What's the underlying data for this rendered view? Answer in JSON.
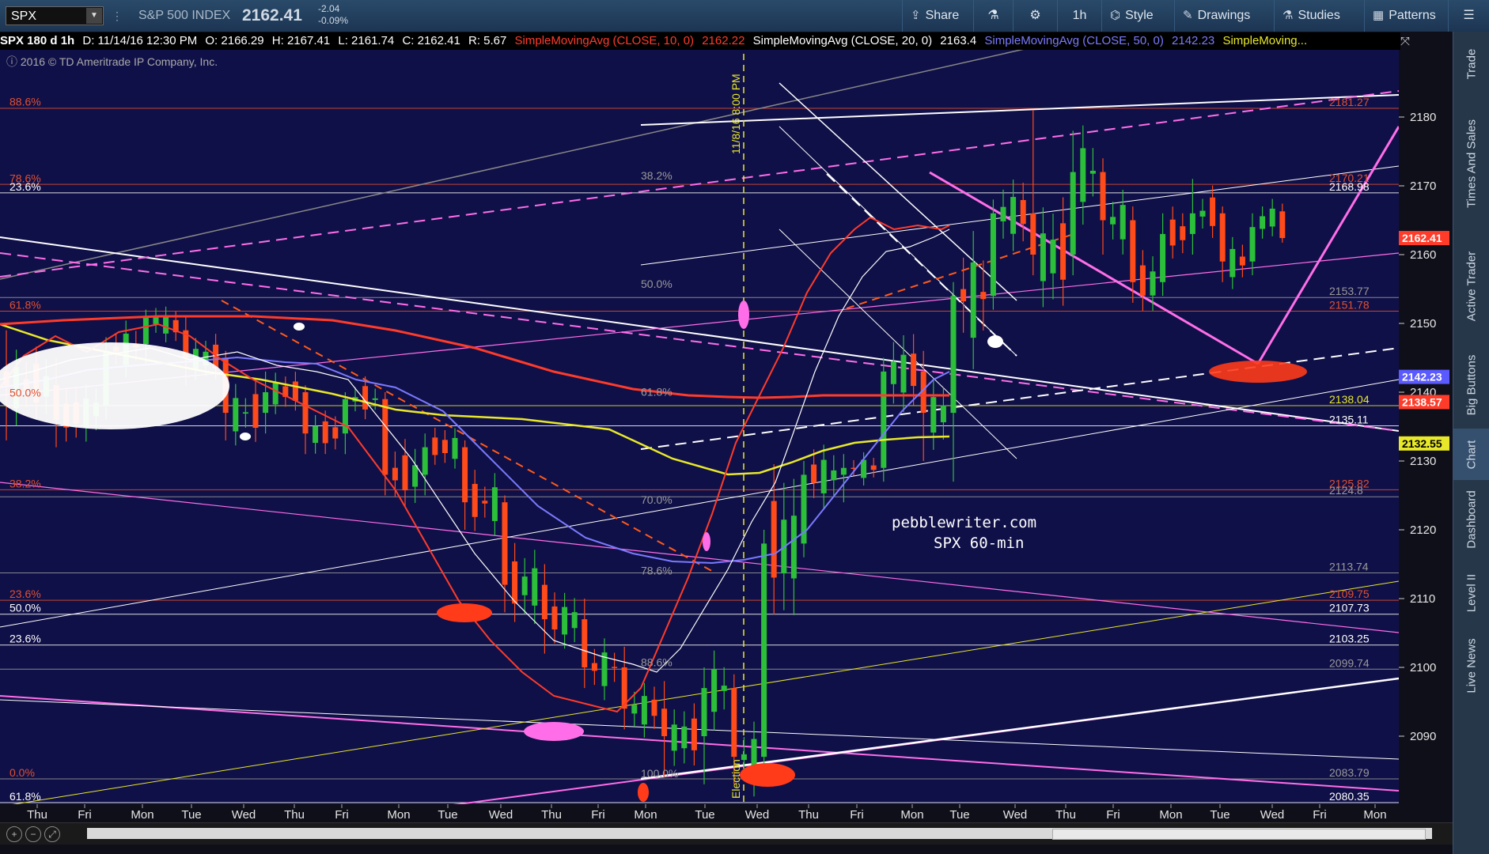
{
  "toolbar": {
    "symbol": "SPX",
    "symbol_name": "S&P 500 INDEX",
    "last_price": "2162.41",
    "change": "-2.04",
    "change_pct": "-0.09%",
    "buttons": {
      "share": "Share",
      "timeframe": "1h",
      "style": "Style",
      "drawings": "Drawings",
      "studies": "Studies",
      "patterns": "Patterns"
    }
  },
  "header": {
    "info": "SPX 180 d 1h",
    "date": "D: 11/14/16 12:30 PM",
    "open": "O: 2166.29",
    "high": "H: 2167.41",
    "low": "L: 2161.74",
    "close": "C: 2162.41",
    "range": "R: 5.67",
    "sma10": "SimpleMovingAvg (CLOSE, 10, 0)",
    "sma10_val": "2162.22",
    "sma20": "SimpleMovingAvg (CLOSE, 20, 0)",
    "sma20_val": "2163.4",
    "sma50": "SimpleMovingAvg (CLOSE, 50, 0)",
    "sma50_val": "2142.23",
    "sma_more": "SimpleMoving...",
    "copyright": "ⓘ 2016 © TD Ameritrade IP Company, Inc."
  },
  "watermark": {
    "line1": "pebblewriter.com",
    "line2": "SPX 60-min"
  },
  "sidebar": {
    "tabs": [
      "Trade",
      "Times And Sales",
      "Active Trader",
      "Big Buttons",
      "Chart",
      "Dashboard",
      "Level II",
      "Live News"
    ],
    "active": "Chart"
  },
  "colors": {
    "background": "#0f0f1a",
    "plot_bg": "#101040",
    "up": "#2bbf3a",
    "down": "#ff4a1a",
    "sma10": "#ff3b2a",
    "sma20": "#ffffff",
    "sma50": "#7a7aff",
    "sma200": "#e8e82a",
    "magenta": "#ff6ee8",
    "fib": "#e05030"
  },
  "chart_data": {
    "type": "candlestick",
    "title": "",
    "ylim": [
      2080,
      2185
    ],
    "y_ticks": [
      2090,
      2100,
      2110,
      2120,
      2130,
      2140,
      2150,
      2160,
      2170,
      2180
    ],
    "x_tick_labels": [
      "Thu",
      "Fri",
      "Mon",
      "Tue",
      "Wed",
      "Thu",
      "Fri",
      "Mon",
      "Tue",
      "Wed",
      "Thu",
      "Fri",
      "Mon",
      "Tue",
      "Wed",
      "Thu",
      "Fri",
      "Mon",
      "Tue",
      "Wed",
      "Thu",
      "Fri",
      "Mon",
      "Tue",
      "Wed",
      "Fri",
      "Mon"
    ],
    "last_price": 2162.41,
    "price_tags": [
      {
        "value": 2162.41,
        "label": "2162.41",
        "color": "#ff3b2a"
      },
      {
        "value": 2142.23,
        "label": "2142.23",
        "color": "#5a5aff"
      },
      {
        "value": 2138.57,
        "label": "2138.57",
        "color": "#ff3b2a"
      },
      {
        "value": 2132.55,
        "label": "2132.55",
        "color": "#e8e82a"
      }
    ],
    "fib_levels_left": [
      {
        "value": 2181.3,
        "label": "88.6%",
        "color": "#e05030"
      },
      {
        "value": 2170.2,
        "label": "78.6%",
        "color": "#e05030"
      },
      {
        "value": 2168.98,
        "label": "23.6%",
        "color": "#ffffff"
      },
      {
        "value": 2151.78,
        "label": "61.8%",
        "color": "#e05030"
      },
      {
        "value": 2139.0,
        "label": "50.0%",
        "color": "#e05030"
      },
      {
        "value": 2125.82,
        "label": "38.2%",
        "color": "#e05030"
      },
      {
        "value": 2109.75,
        "label": "23.6%",
        "color": "#e05030"
      },
      {
        "value": 2107.73,
        "label": "50.0%",
        "color": "#ffffff"
      },
      {
        "value": 2103.25,
        "label": "23.6%",
        "color": "#ffffff"
      },
      {
        "value": 2083.79,
        "label": "0.0%",
        "color": "#e05030"
      },
      {
        "value": 2080.35,
        "label": "61.8%",
        "color": "#ffffff"
      }
    ],
    "fib_levels_right": [
      {
        "value": 2181.27,
        "label": "2181.27",
        "color": "#e05030"
      },
      {
        "value": 2170.21,
        "label": "2170.21",
        "color": "#e05030"
      },
      {
        "value": 2168.98,
        "label": "2168.98",
        "color": "#ffffff"
      },
      {
        "value": 2153.77,
        "label": "2153.77",
        "color": "#9a9a9a"
      },
      {
        "value": 2151.78,
        "label": "2151.78",
        "color": "#e05030"
      },
      {
        "value": 2138.04,
        "label": "2138.04",
        "color": "#e8e82a"
      },
      {
        "value": 2135.11,
        "label": "2135.11",
        "color": "#ffffff"
      },
      {
        "value": 2125.82,
        "label": "2125.82",
        "color": "#e05030"
      },
      {
        "value": 2124.8,
        "label": "2124.8",
        "color": "#9a9a9a"
      },
      {
        "value": 2113.74,
        "label": "2113.74",
        "color": "#9a9a9a"
      },
      {
        "value": 2109.75,
        "label": "2109.75",
        "color": "#e05030"
      },
      {
        "value": 2107.73,
        "label": "2107.73",
        "color": "#ffffff"
      },
      {
        "value": 2103.25,
        "label": "2103.25",
        "color": "#ffffff"
      },
      {
        "value": 2099.74,
        "label": "2099.74",
        "color": "#9a9a9a"
      },
      {
        "value": 2083.79,
        "label": "2083.79",
        "color": "#9a9a9a"
      },
      {
        "value": 2080.35,
        "label": "2080.35",
        "color": "#ffffff"
      }
    ],
    "fib_mid_labels": [
      {
        "value": 2170.9,
        "label": "38.2%"
      },
      {
        "value": 2155.2,
        "label": "50.0%"
      },
      {
        "value": 2139.5,
        "label": "61.8%"
      },
      {
        "value": 2123.8,
        "label": "70.0%"
      },
      {
        "value": 2113.5,
        "label": "78.6%"
      },
      {
        "value": 2100.2,
        "label": "88.6%"
      },
      {
        "value": 2084.0,
        "label": "100.0%"
      }
    ],
    "annotations": {
      "vertical_event_date": "11/8/16 8:00 PM",
      "vertical_event_label": "Election"
    },
    "candles_summary": [
      {
        "bar": 0,
        "o": 2143,
        "h": 2149,
        "l": 2133,
        "c": 2141
      },
      {
        "bar": 5,
        "o": 2141,
        "h": 2145,
        "l": 2132,
        "c": 2136
      },
      {
        "bar": 10,
        "o": 2138,
        "h": 2148,
        "l": 2136,
        "c": 2146
      },
      {
        "bar": 14,
        "o": 2147,
        "h": 2152,
        "l": 2144,
        "c": 2151
      },
      {
        "bar": 18,
        "o": 2149,
        "h": 2151,
        "l": 2141,
        "c": 2145
      },
      {
        "bar": 22,
        "o": 2145,
        "h": 2146,
        "l": 2133,
        "c": 2137
      },
      {
        "bar": 26,
        "o": 2137,
        "h": 2143,
        "l": 2134,
        "c": 2140
      },
      {
        "bar": 30,
        "o": 2140,
        "h": 2141,
        "l": 2131,
        "c": 2134
      },
      {
        "bar": 34,
        "o": 2134,
        "h": 2140,
        "l": 2131,
        "c": 2139
      },
      {
        "bar": 38,
        "o": 2139,
        "h": 2140,
        "l": 2125,
        "c": 2128
      },
      {
        "bar": 42,
        "o": 2128,
        "h": 2134,
        "l": 2125,
        "c": 2132
      },
      {
        "bar": 46,
        "o": 2132,
        "h": 2133,
        "l": 2120,
        "c": 2124
      },
      {
        "bar": 50,
        "o": 2124,
        "h": 2125,
        "l": 2108,
        "c": 2112
      },
      {
        "bar": 54,
        "o": 2112,
        "h": 2115,
        "l": 2102,
        "c": 2107
      },
      {
        "bar": 58,
        "o": 2107,
        "h": 2110,
        "l": 2097,
        "c": 2100
      },
      {
        "bar": 62,
        "o": 2100,
        "h": 2103,
        "l": 2091,
        "c": 2094
      },
      {
        "bar": 66,
        "o": 2094,
        "h": 2098,
        "l": 2084,
        "c": 2090
      },
      {
        "bar": 70,
        "o": 2090,
        "h": 2100,
        "l": 2083,
        "c": 2097
      },
      {
        "bar": 73,
        "o": 2097,
        "h": 2099,
        "l": 2083,
        "c": 2087
      },
      {
        "bar": 76,
        "o": 2087,
        "h": 2120,
        "l": 2086,
        "c": 2118
      },
      {
        "bar": 80,
        "o": 2118,
        "h": 2130,
        "l": 2116,
        "c": 2128
      },
      {
        "bar": 84,
        "o": 2128,
        "h": 2131,
        "l": 2124,
        "c": 2129
      },
      {
        "bar": 88,
        "o": 2129,
        "h": 2145,
        "l": 2127,
        "c": 2143
      },
      {
        "bar": 92,
        "o": 2143,
        "h": 2146,
        "l": 2130,
        "c": 2137
      },
      {
        "bar": 95,
        "o": 2137,
        "h": 2156,
        "l": 2127,
        "c": 2154
      },
      {
        "bar": 99,
        "o": 2154,
        "h": 2168,
        "l": 2152,
        "c": 2166
      },
      {
        "bar": 103,
        "o": 2166,
        "h": 2181,
        "l": 2157,
        "c": 2160
      },
      {
        "bar": 107,
        "o": 2160,
        "h": 2178,
        "l": 2157,
        "c": 2172
      },
      {
        "bar": 110,
        "o": 2172,
        "h": 2174,
        "l": 2160,
        "c": 2165
      },
      {
        "bar": 113,
        "o": 2165,
        "h": 2167,
        "l": 2153,
        "c": 2156
      },
      {
        "bar": 116,
        "o": 2156,
        "h": 2166,
        "l": 2154,
        "c": 2163
      },
      {
        "bar": 119,
        "o": 2163,
        "h": 2171,
        "l": 2160,
        "c": 2166
      },
      {
        "bar": 122,
        "o": 2166,
        "h": 2167,
        "l": 2156,
        "c": 2159
      },
      {
        "bar": 125,
        "o": 2159,
        "h": 2166,
        "l": 2157,
        "c": 2164
      },
      {
        "bar": 128,
        "o": 2166.29,
        "h": 2167.41,
        "l": 2161.74,
        "c": 2162.41
      }
    ]
  }
}
